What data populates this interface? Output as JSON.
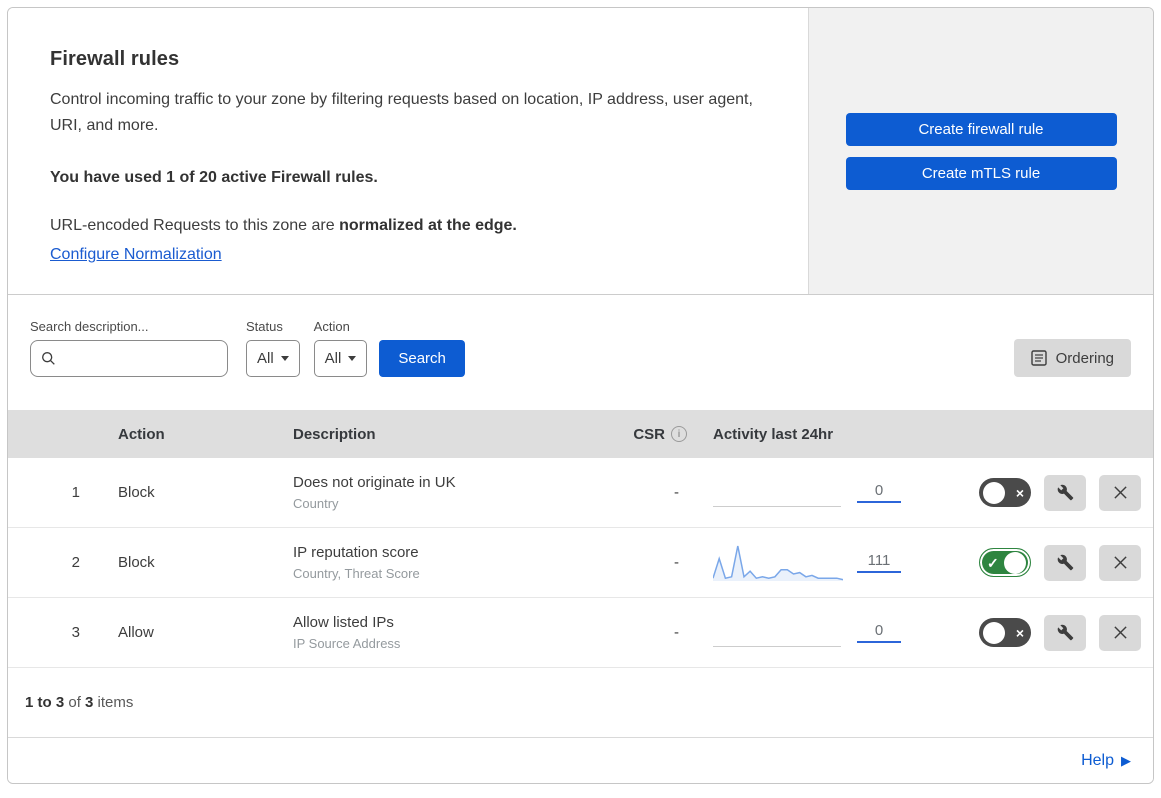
{
  "header": {
    "title": "Firewall rules",
    "description": "Control incoming traffic to your zone by filtering requests based on location, IP address, user agent, URI, and more.",
    "usage": "You have used 1 of 20 active Firewall rules.",
    "normalization_prefix": "URL-encoded Requests to this zone are ",
    "normalization_bold": "normalized at the edge.",
    "normalization_link": "Configure Normalization",
    "buttons": [
      {
        "label": "Create firewall rule"
      },
      {
        "label": "Create mTLS rule"
      }
    ]
  },
  "filters": {
    "search_label": "Search description...",
    "search_value": "",
    "status_label": "Status",
    "status_value": "All",
    "action_label": "Action",
    "action_value": "All",
    "search_button": "Search",
    "ordering_button": "Ordering"
  },
  "table": {
    "columns": {
      "action": "Action",
      "description": "Description",
      "csr": "CSR",
      "activity": "Activity last 24hr"
    },
    "rows": [
      {
        "priority": "1",
        "action": "Block",
        "description": "Does not originate in UK",
        "fields": "Country",
        "csr": "-",
        "activity_count": "0",
        "has_sparkline": false,
        "enabled": false
      },
      {
        "priority": "2",
        "action": "Block",
        "description": "IP reputation score",
        "fields": "Country, Threat Score",
        "csr": "-",
        "activity_count": "111",
        "has_sparkline": true,
        "enabled": true
      },
      {
        "priority": "3",
        "action": "Allow",
        "description": "Allow listed IPs",
        "fields": "IP Source Address",
        "csr": "-",
        "activity_count": "0",
        "has_sparkline": false,
        "enabled": false
      }
    ]
  },
  "chart_data": {
    "type": "area",
    "title": "Activity last 24hr sparkline (rule 2: IP reputation score)",
    "x_meaning": "time buckets across last 24 hours",
    "values": [
      2,
      16,
      2,
      3,
      25,
      3,
      7,
      2,
      3,
      2,
      3,
      8,
      8,
      5,
      6,
      3,
      4,
      2,
      2,
      2,
      2,
      1
    ],
    "total": 111,
    "line_color": "#7aa7e9",
    "fill_color": "rgba(122,167,233,0.16)",
    "flat_rows_value": 0
  },
  "footer": {
    "range": "1 to 3",
    "of": " of ",
    "total": "3",
    "items": " items"
  },
  "help": {
    "label": "Help"
  },
  "icons": {
    "info_glyph": "i",
    "toggle_on_glyph": "✓",
    "toggle_off_glyph": "×",
    "help_arrow_glyph": "▶"
  },
  "colors": {
    "accent_blue": "#0d5cd2",
    "toggle_on_green": "#2e8540",
    "toggle_off_gray": "#4a4a4a",
    "table_header_gray": "#dedede",
    "panel_gray": "#f1f1f1",
    "sparkline_blue": "#7aa7e9",
    "count_underline_blue": "#2c65d9"
  }
}
